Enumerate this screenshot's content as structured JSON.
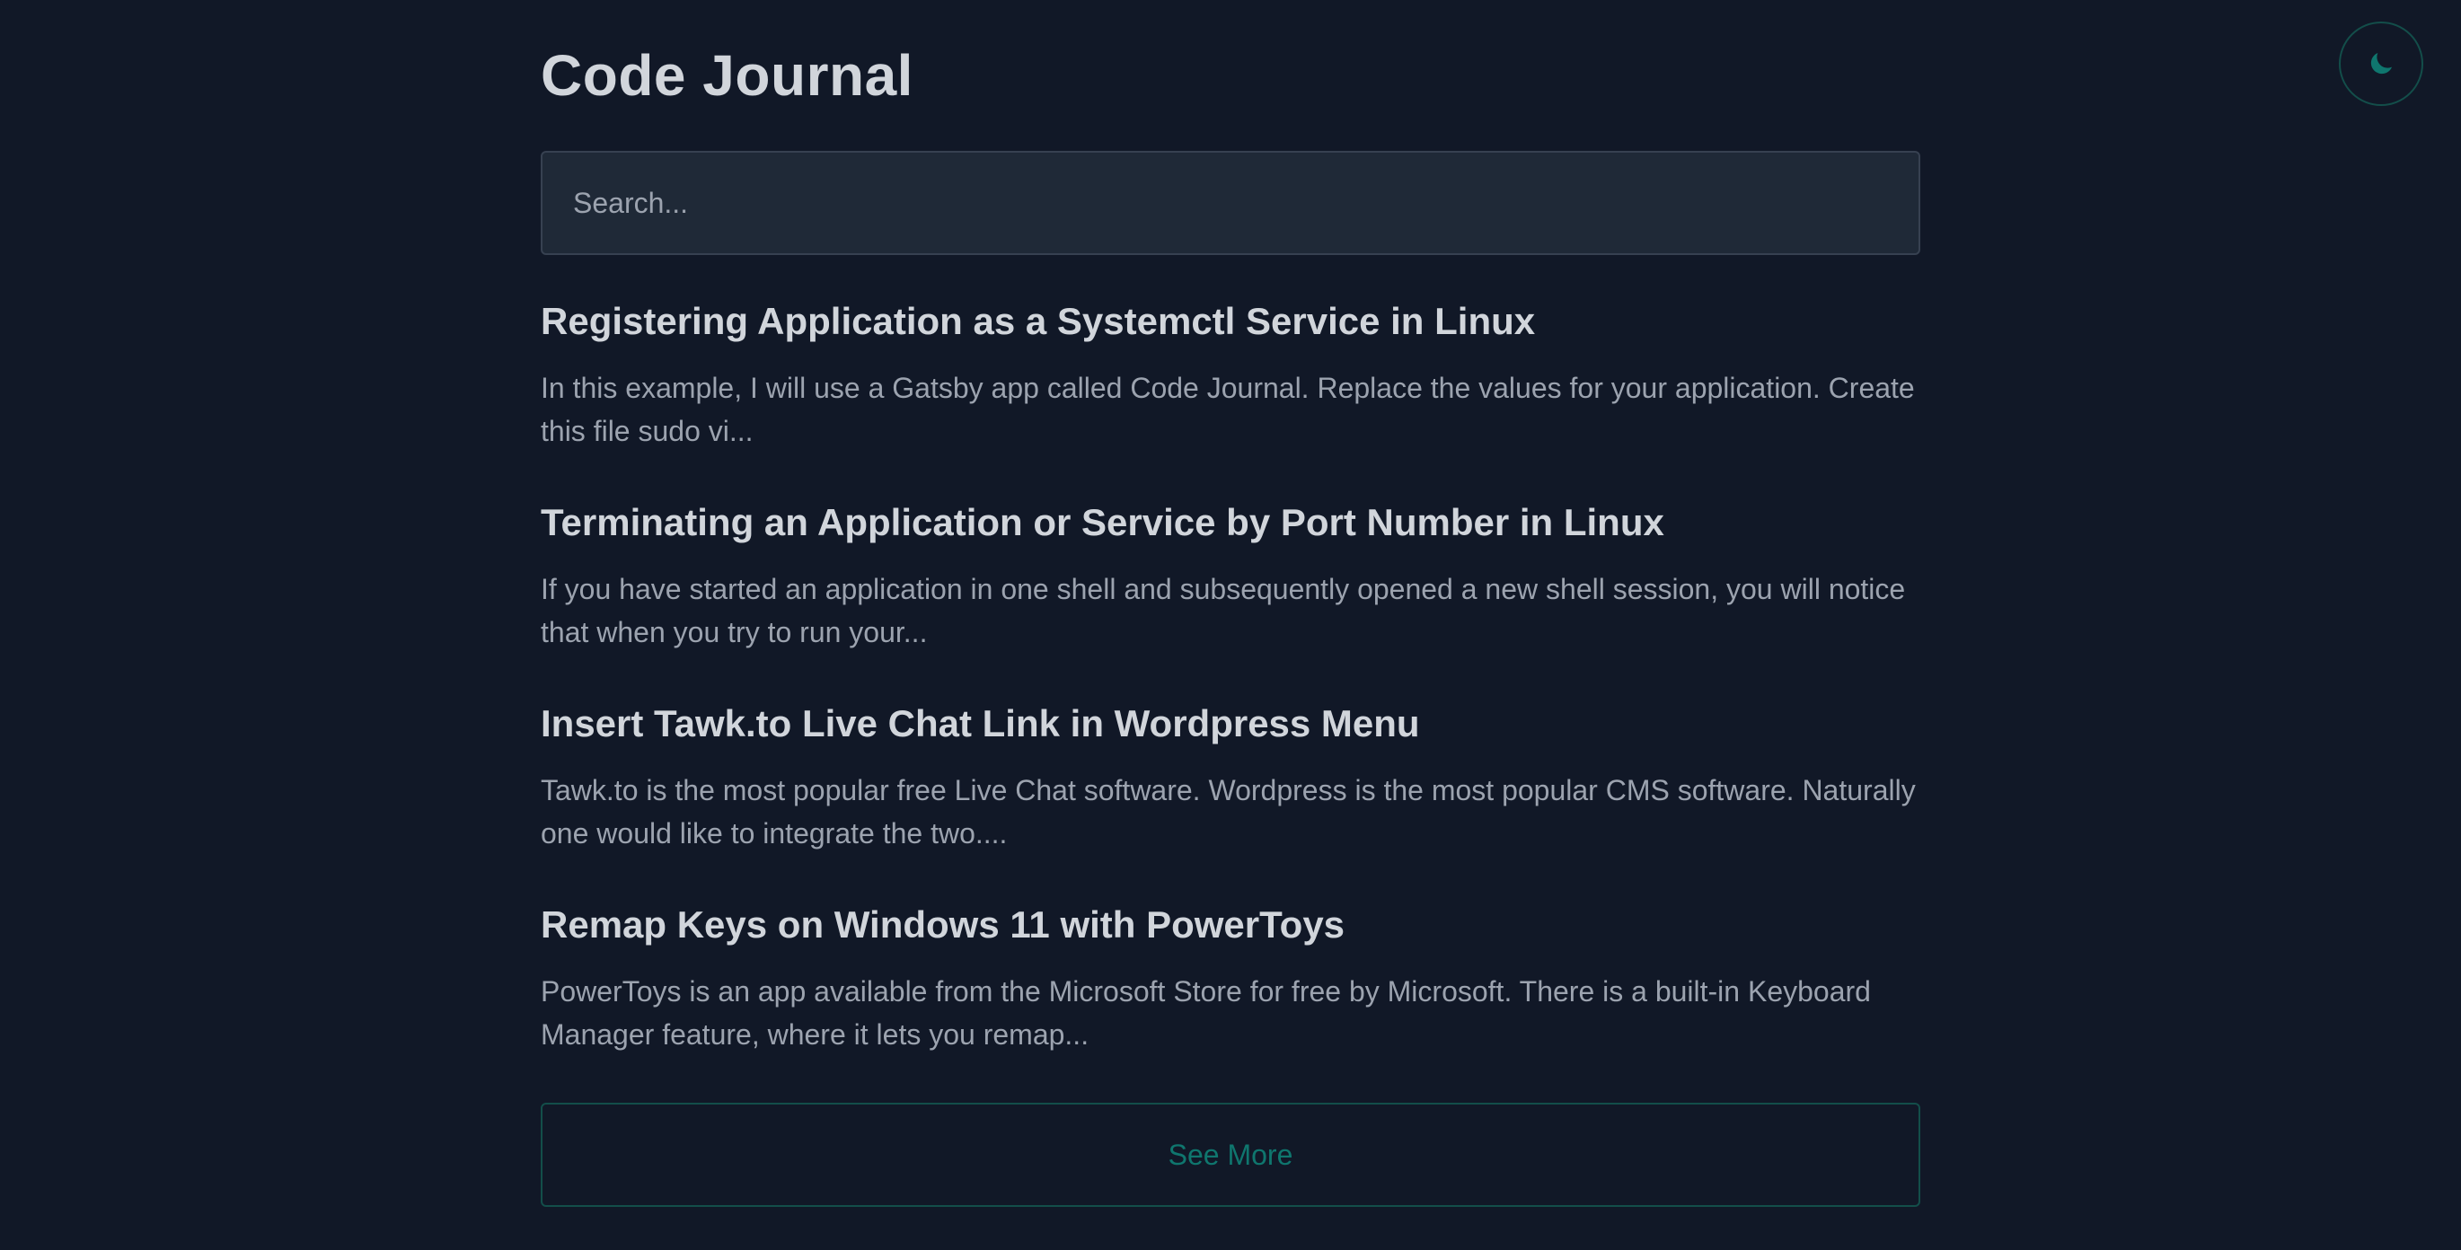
{
  "header": {
    "title": "Code Journal",
    "theme_toggle_icon": "moon-icon"
  },
  "search": {
    "placeholder": "Search...",
    "value": ""
  },
  "posts": [
    {
      "title": "Registering Application as a Systemctl Service in Linux",
      "excerpt": "In this example, I will use a Gatsby app called Code Journal. Replace the values for your application. Create this file sudo vi..."
    },
    {
      "title": "Terminating an Application or Service by Port Number in Linux",
      "excerpt": "If you have started an application in one shell and subsequently opened a new shell session, you will notice that when you try to run your..."
    },
    {
      "title": "Insert Tawk.to Live Chat Link in Wordpress Menu",
      "excerpt": "Tawk.to is the most popular free Live Chat software. Wordpress is the most popular CMS software. Naturally one would like to integrate the two...."
    },
    {
      "title": "Remap Keys on Windows 11 with PowerToys",
      "excerpt": "PowerToys is an app available from the Microsoft Store for free by Microsoft. There is a built-in Keyboard Manager feature, where it lets you remap..."
    }
  ],
  "see_more_label": "See More",
  "colors": {
    "background": "#111827",
    "accent": "#0f766e",
    "title": "#d1d5db",
    "text": "#9ca3af",
    "input_bg": "#1f2937"
  }
}
